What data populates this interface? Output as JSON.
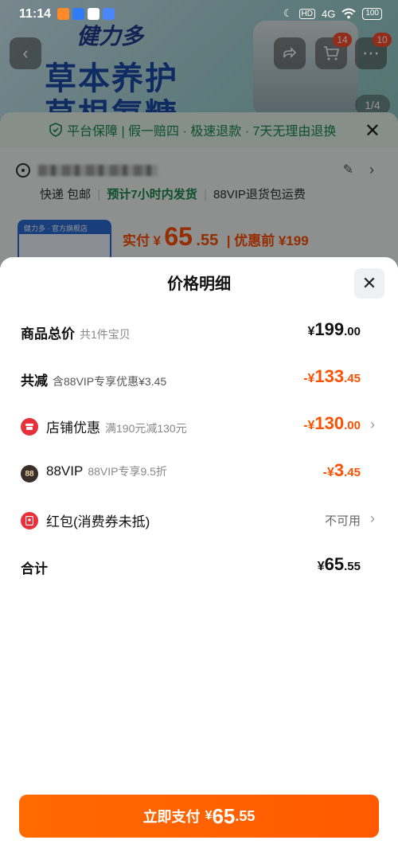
{
  "status_bar": {
    "time": "11:14",
    "network": "4G",
    "battery": "100"
  },
  "background": {
    "brand": "健力多",
    "headline_line1": "草本养护",
    "headline_line2": "草根氨糖",
    "cart_badge": "14",
    "more_badge": "10",
    "image_counter": "1/4",
    "guarantee": "平台保障 | 假一赔四 · 极速退款 · 7天无理由退换",
    "shipping_express": "快递 包邮",
    "shipping_promise": "预计7小时内发货",
    "shipping_vip": "88VIP退货包运费",
    "thumb_label": "健力多 · 官方旗舰店",
    "price_label": "实付",
    "price_currency": "¥",
    "price_int": "65",
    "price_dec": ".55",
    "price_before": "| 优惠前 ¥199"
  },
  "sheet": {
    "title": "价格明细",
    "rows": {
      "total": {
        "label": "商品总价",
        "sub": "共1件宝贝",
        "currency": "¥",
        "int": "199",
        "dec": ".00"
      },
      "discount": {
        "label": "共减",
        "sub": "含88VIP专享优惠¥3.45",
        "currency": "-¥",
        "int": "133",
        "dec": ".45"
      },
      "store": {
        "label": "店铺优惠",
        "sub": "满190元减130元",
        "currency": "-¥",
        "int": "130",
        "dec": ".00"
      },
      "vip": {
        "label": "88VIP",
        "sub": "88VIP专享9.5折",
        "icon_text": "88",
        "currency": "-¥",
        "int": "3",
        "dec": ".45"
      },
      "redpacket": {
        "label": "红包(消费券未抵)",
        "status": "不可用"
      },
      "sum": {
        "label": "合计",
        "currency": "¥",
        "int": "65",
        "dec": ".55"
      }
    },
    "pay_button": {
      "label": "立即支付",
      "currency": "¥",
      "int": "65",
      "dec": ".55"
    }
  },
  "colors": {
    "accent_orange": "#ff5000",
    "guarantee_green": "#1b8a4c",
    "store_icon_red": "#e8303a",
    "vip_icon_dark": "#3a2e2a"
  }
}
